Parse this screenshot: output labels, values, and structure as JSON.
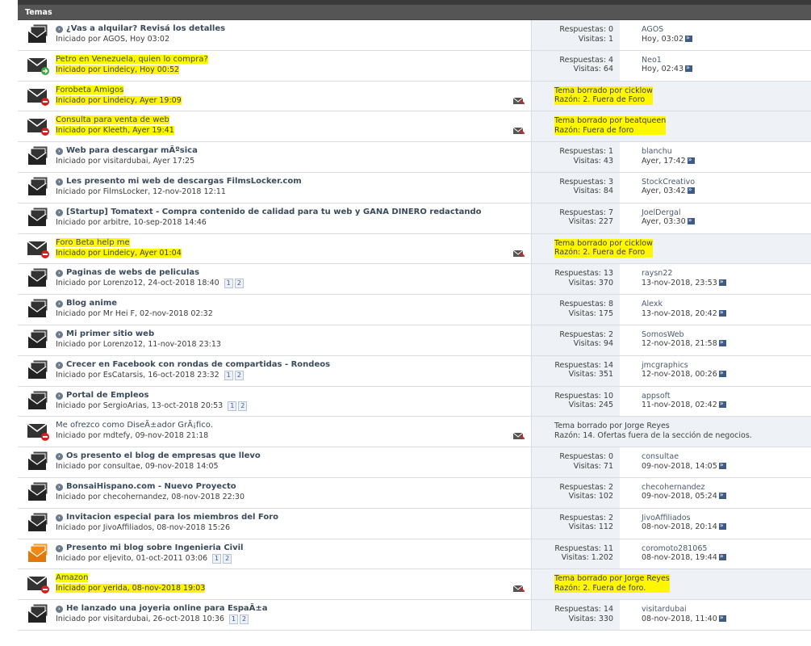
{
  "header": {
    "title": "Temas"
  },
  "colors": {
    "highlight": "#fff700",
    "header_bg": "#555555",
    "stats_bg": "#eef2f6"
  },
  "threads": [
    {
      "icon": "stack",
      "bold": true,
      "title": "¿Vas a alquilar? Revisá los detalles",
      "starter": "Iniciado por AGOS, Hoy 03:02",
      "replies": "Respuestas: 0",
      "views": "Visitas: 1",
      "last_user": "AGOS",
      "last_date": "Hoy, 03:02"
    },
    {
      "icon": "envelope-arrow",
      "highlight": true,
      "title": "Petro en Venezuela, quien lo compra?",
      "starter": "Iniciado por Lindeicy, Hoy 00:52",
      "replies": "Respuestas: 4",
      "views": "Visitas: 64",
      "last_user": "Neo1",
      "last_date": "Hoy, 02:43"
    },
    {
      "icon": "envelope-deleted",
      "highlight": true,
      "deleted": true,
      "title": "Forobeta Amigos",
      "starter": "Iniciado por Lindeicy, Ayer 19:09",
      "del_by": "Tema borrado por cicklow",
      "del_reason": "Razón:  2. Fuera de Foro"
    },
    {
      "icon": "envelope-deleted",
      "highlight": true,
      "deleted": true,
      "title": "Consulta para venta de web",
      "starter": "Iniciado por Kleeth, Ayer 19:41",
      "del_by": "Tema borrado por beatqueen",
      "del_reason": "Razón:  Fuera de foro"
    },
    {
      "icon": "stack",
      "bold": true,
      "title": "Web para descargar mÃºsica",
      "starter": "Iniciado por visitardubai, Ayer 17:25",
      "replies": "Respuestas: 1",
      "views": "Visitas: 43",
      "last_user": "blanchu",
      "last_date": "Ayer, 17:42"
    },
    {
      "icon": "stack",
      "bold": true,
      "title": "Les presento mi web de descargas FilmsLocker.com",
      "starter": "Iniciado por FilmsLocker, 12-nov-2018 12:11",
      "replies": "Respuestas: 3",
      "views": "Visitas: 84",
      "last_user": "StockCreativo",
      "last_date": "Ayer, 03:42"
    },
    {
      "icon": "stack",
      "bold": true,
      "title": "[Startup] Tomatext - Compra contenido de calidad para tu web y GANA DINERO redactando",
      "starter": "Iniciado por arbitre, 10-sep-2018 14:46",
      "replies": "Respuestas: 7",
      "views": "Visitas: 227",
      "last_user": "JoelDergal",
      "last_date": "Ayer, 03:30"
    },
    {
      "icon": "envelope-deleted",
      "highlight": true,
      "deleted": true,
      "title": "Foro Beta help me",
      "starter": "Iniciado por Lindeicy, Ayer 01:04",
      "del_by": "Tema borrado por cicklow",
      "del_reason": "Razón:  2. Fuera de Foro"
    },
    {
      "icon": "stack",
      "bold": true,
      "title": "Paginas de webs de peliculas",
      "starter": "Iniciado por Lorenzo12, 24-oct-2018 18:40",
      "pages": [
        "1",
        "2"
      ],
      "replies": "Respuestas: 13",
      "views": "Visitas: 370",
      "last_user": "raysn22",
      "last_date": "13-nov-2018, 23:53"
    },
    {
      "icon": "stack",
      "bold": true,
      "title": "Blog anime",
      "starter": "Iniciado por Mr Hei F, 02-nov-2018 02:32",
      "replies": "Respuestas: 8",
      "views": "Visitas: 175",
      "last_user": "Alexk",
      "last_date": "13-nov-2018, 20:42"
    },
    {
      "icon": "stack",
      "bold": true,
      "title": "Mi primer sitio web",
      "starter": "Iniciado por Lorenzo12, 11-nov-2018 23:13",
      "replies": "Respuestas: 2",
      "views": "Visitas: 94",
      "last_user": "SomosWeb",
      "last_date": "12-nov-2018, 21:58"
    },
    {
      "icon": "stack",
      "bold": true,
      "title": "Crecer en Facebook con rondas de compartidas - Rondeos",
      "starter": "Iniciado por EsCatarsis, 16-oct-2018 23:32",
      "pages": [
        "1",
        "2"
      ],
      "replies": "Respuestas: 14",
      "views": "Visitas: 351",
      "last_user": "jmcgraphics",
      "last_date": "12-nov-2018, 00:26"
    },
    {
      "icon": "stack",
      "bold": true,
      "title": "Portal de Empleos",
      "starter": "Iniciado por SergioArias, 13-oct-2018 20:53",
      "pages": [
        "1",
        "2"
      ],
      "replies": "Respuestas: 10",
      "views": "Visitas: 245",
      "last_user": "appsoft",
      "last_date": "11-nov-2018, 02:42"
    },
    {
      "icon": "envelope-deleted",
      "deleted": true,
      "title": "Me ofrezco como DiseÃ±ador GrÃ¡fico.",
      "starter": "Iniciado por mdtefy, 09-nov-2018 21:18",
      "del_by": "Tema borrado por Jorge Reyes",
      "del_reason": "Razón:  14. Ofertas fuera de la sección de negocios."
    },
    {
      "icon": "stack",
      "bold": true,
      "title": "Os presento el blog de empresas que llevo",
      "starter": "Iniciado por consultae, 09-nov-2018 14:05",
      "replies": "Respuestas: 0",
      "views": "Visitas: 71",
      "last_user": "consultae",
      "last_date": "09-nov-2018, 14:05"
    },
    {
      "icon": "stack",
      "bold": true,
      "title": "BonsaiHispano.com - Nuevo Proyecto",
      "starter": "Iniciado por checohernandez, 08-nov-2018 22:30",
      "replies": "Respuestas: 2",
      "views": "Visitas: 102",
      "last_user": "checohernandez",
      "last_date": "09-nov-2018, 05:24"
    },
    {
      "icon": "stack",
      "bold": true,
      "title": "Invitacion especial para los miembros del Foro",
      "starter": "Iniciado por JivoAffiliados, 08-nov-2018 15:26",
      "replies": "Respuestas: 2",
      "views": "Visitas: 112",
      "last_user": "JivoAffiliados",
      "last_date": "08-nov-2018, 20:14"
    },
    {
      "icon": "stack-orange",
      "bold": true,
      "title": "Presento mi blog sobre Ingenieria Civil",
      "starter": "Iniciado por eljevito, 01-oct-2011 03:06",
      "pages": [
        "1",
        "2"
      ],
      "replies": "Respuestas: 11",
      "views": "Visitas: 1.202",
      "last_user": "coromoto281065",
      "last_date": "08-nov-2018, 19:44"
    },
    {
      "icon": "envelope-deleted",
      "highlight": true,
      "deleted": true,
      "title": "Amazon",
      "starter": "Iniciado por yerida, 08-nov-2018 19:03",
      "del_by": "Tema borrado por Jorge Reyes",
      "del_reason": "Razón:  2. Fuera de foro."
    },
    {
      "icon": "stack",
      "bold": true,
      "title": "He lanzado una joyeria online para EspaÃ±a",
      "starter": "Iniciado por visitardubai, 26-oct-2018 10:36",
      "pages": [
        "1",
        "2"
      ],
      "replies": "Respuestas: 14",
      "views": "Visitas: 330",
      "last_user": "visitardubai",
      "last_date": "08-nov-2018, 11:40"
    }
  ]
}
